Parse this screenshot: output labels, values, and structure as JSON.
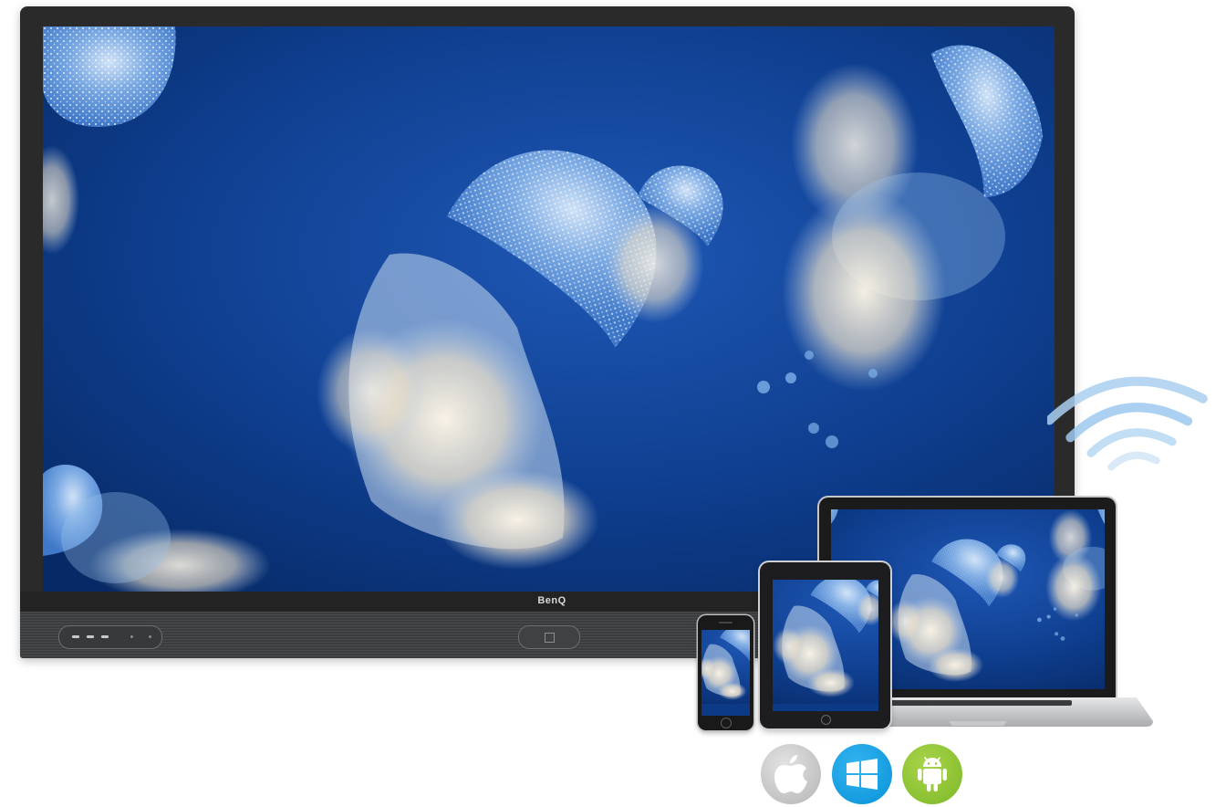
{
  "display": {
    "brand": "BenQ",
    "colors": {
      "bezel": "#2a2a2b",
      "screen_water": "#0d3a86",
      "jellyfish": "#9fc3ec"
    }
  },
  "devices": {
    "laptop": {
      "content": "jellyfish-wallpaper"
    },
    "tablet": {
      "content": "jellyfish-wallpaper"
    },
    "phone": {
      "content": "jellyfish-wallpaper"
    }
  },
  "wireless": {
    "icon": "wifi-icon",
    "color": "#8ec3ea"
  },
  "os_badges": [
    {
      "name": "apple-icon",
      "color": "#c9c9c9"
    },
    {
      "name": "windows-icon",
      "color": "#0b9de0"
    },
    {
      "name": "android-icon",
      "color": "#8cc63f"
    }
  ]
}
